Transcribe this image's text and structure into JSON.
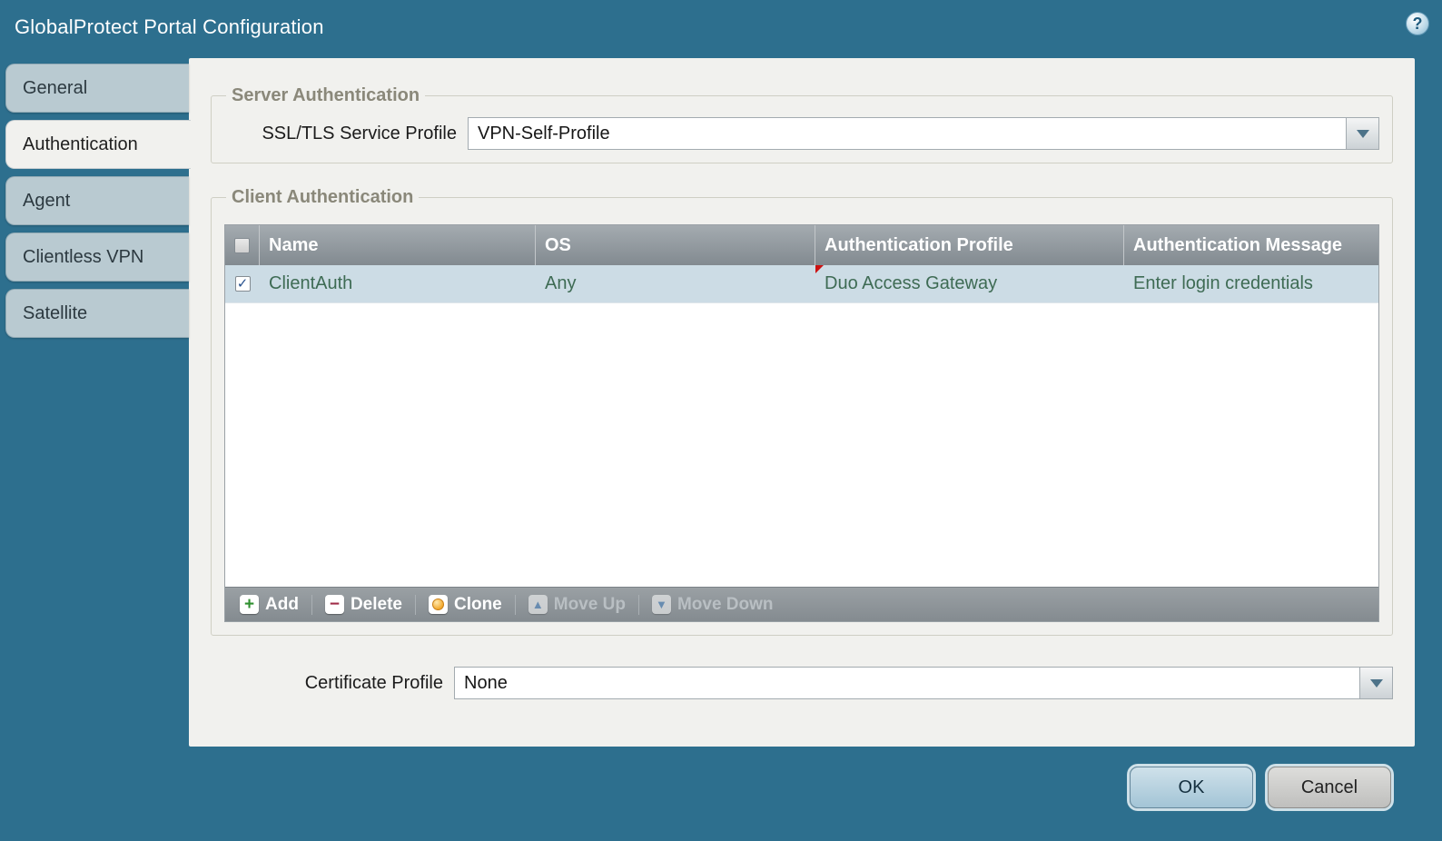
{
  "window": {
    "title": "GlobalProtect Portal Configuration"
  },
  "icons": {
    "help": "?",
    "check": "✓",
    "add": "+",
    "delete": "−",
    "move_up": "▲",
    "move_down": "▼"
  },
  "sidebar": {
    "items": [
      {
        "label": "General",
        "active": false
      },
      {
        "label": "Authentication",
        "active": true
      },
      {
        "label": "Agent",
        "active": false
      },
      {
        "label": "Clientless VPN",
        "active": false
      },
      {
        "label": "Satellite",
        "active": false
      }
    ]
  },
  "server_auth": {
    "legend": "Server Authentication",
    "ssl_profile_label": "SSL/TLS Service Profile",
    "ssl_profile_value": "VPN-Self-Profile"
  },
  "client_auth": {
    "legend": "Client Authentication",
    "table": {
      "columns": [
        "Name",
        "OS",
        "Authentication Profile",
        "Authentication Message"
      ],
      "rows": [
        {
          "checked": true,
          "name": "ClientAuth",
          "os": "Any",
          "auth_profile": "Duo Access Gateway",
          "auth_profile_modified": true,
          "auth_message": "Enter login credentials"
        }
      ]
    },
    "toolbar": [
      {
        "label": "Add",
        "enabled": true
      },
      {
        "label": "Delete",
        "enabled": true
      },
      {
        "label": "Clone",
        "enabled": true
      },
      {
        "label": "Move Up",
        "enabled": false
      },
      {
        "label": "Move Down",
        "enabled": false
      }
    ]
  },
  "certificate": {
    "label": "Certificate Profile",
    "value": "None"
  },
  "footer": {
    "ok_label": "OK",
    "cancel_label": "Cancel"
  },
  "colors": {
    "background": "#2d6f8e",
    "panel": "#f1f1ee",
    "selected_row": "#ccdce5",
    "row_text": "#3e6b54",
    "modified_marker": "#cc1111"
  }
}
